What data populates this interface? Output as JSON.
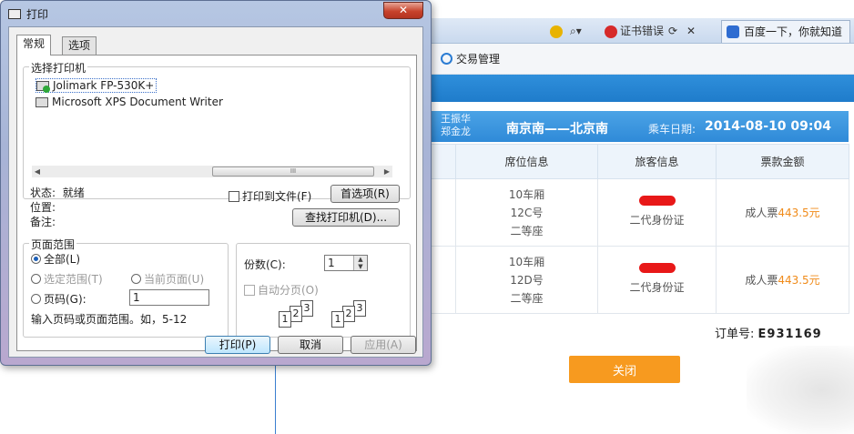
{
  "browser": {
    "toolbar_cert_error": "证书错误",
    "tab_baidu_label": "百度一下，你就知道",
    "nav_item": "交易管理"
  },
  "ticket": {
    "passenger_names": [
      "王振华",
      "郑金龙"
    ],
    "route": "南京南——北京南",
    "date_label": "乘车日期:",
    "date_value": "2014-08-10 09:04",
    "columns": [
      "席位信息",
      "旅客信息",
      "票款金额"
    ],
    "rows": [
      {
        "car": "10车厢",
        "seat": "12C号",
        "class": "二等座",
        "id_type": "二代身份证",
        "fare_type": "成人票",
        "price": "443.5元"
      },
      {
        "car": "10车厢",
        "seat": "12D号",
        "class": "二等座",
        "id_type": "二代身份证",
        "fare_type": "成人票",
        "price": "443.5元"
      }
    ],
    "order_label": "订单号:",
    "order_number": "E931169",
    "close_label": "关闭"
  },
  "dialog": {
    "title": "打印",
    "close_glyph": "✕",
    "tabs": [
      "常规",
      "选项"
    ],
    "select_printer_label": "选择打印机",
    "printers": [
      "Jolimark FP-530K+",
      "Microsoft XPS Document Writer"
    ],
    "scroll_thumb_glyph": "III",
    "status_label": "状态:",
    "status_value": "就绪",
    "location_label": "位置:",
    "comment_label": "备注:",
    "print_to_file": "打印到文件(F)",
    "preferences_button": "首选项(R)",
    "find_printer_button": "查找打印机(D)...",
    "page_range": {
      "label": "页面范围",
      "all": "全部(L)",
      "selection": "选定范围(T)",
      "current": "当前页面(U)",
      "pages": "页码(G):",
      "pages_value": "1",
      "hint": "输入页码或页面范围。如，5-12"
    },
    "copies": {
      "label": "份数(C):",
      "value": "1",
      "collate": "自动分页(O)"
    },
    "buttons": {
      "print": "打印(P)",
      "cancel": "取消",
      "apply": "应用(A)"
    }
  }
}
